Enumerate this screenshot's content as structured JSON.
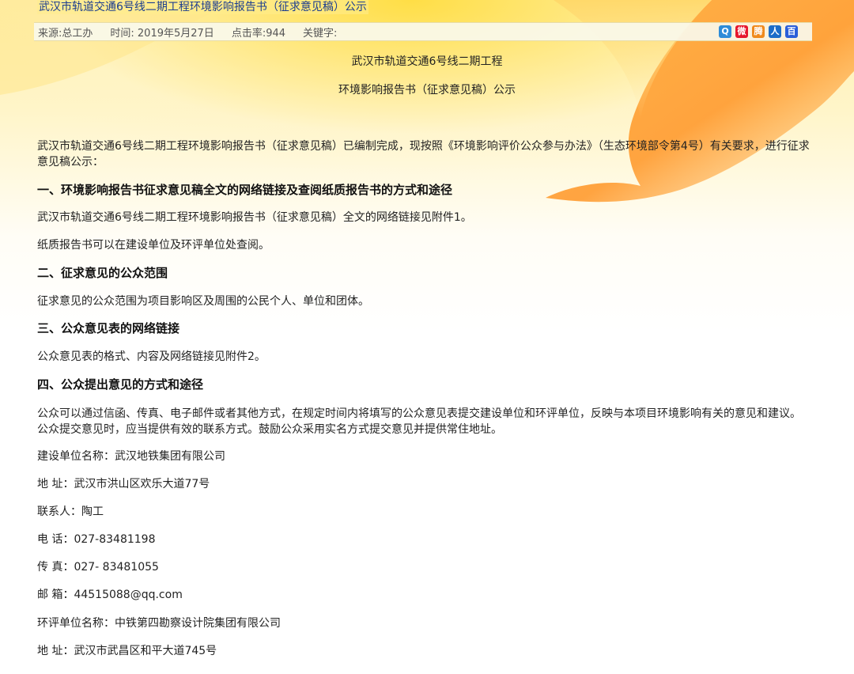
{
  "page": {
    "title": "武汉市轨道交通6号线二期工程环境影响报告书（征求意见稿）公示"
  },
  "meta": {
    "source": "来源:总工办",
    "time": "时间: 2019年5月27日",
    "hits": "点击率:944",
    "keywords": "关键字:"
  },
  "share_icons": [
    {
      "name": "qq-zone-icon",
      "glyph": "Q",
      "color": "#2d8cd9"
    },
    {
      "name": "weibo-icon",
      "glyph": "微",
      "color": "#e6162d"
    },
    {
      "name": "tencent-weibo-icon",
      "glyph": "腾",
      "color": "#f08a1c"
    },
    {
      "name": "renren-icon",
      "glyph": "人",
      "color": "#1c6dc8"
    },
    {
      "name": "baidu-icon",
      "glyph": "百",
      "color": "#2b5fd9"
    }
  ],
  "document": {
    "heading_line1": "武汉市轨道交通6号线二期工程",
    "heading_line2": "环境影响报告书（征求意见稿）公示",
    "intro": "武汉市轨道交通6号线二期工程环境影响报告书（征求意见稿）已编制完成，现按照《环境影响评价公众参与办法》（生态环境部令第4号）有关要求，进行征求意见稿公示：",
    "section1_title": "一、环境影响报告书征求意见稿全文的网络链接及查阅纸质报告书的方式和途径",
    "section1_p1": "武汉市轨道交通6号线二期工程环境影响报告书（征求意见稿）全文的网络链接见附件1。",
    "section1_p2": "纸质报告书可以在建设单位及环评单位处查阅。",
    "section2_title": "二、征求意见的公众范围",
    "section2_p1": "征求意见的公众范围为项目影响区及周围的公民个人、单位和团体。",
    "section3_title": "三、公众意见表的网络链接",
    "section3_p1": "公众意见表的格式、内容及网络链接见附件2。",
    "section4_title": "四、公众提出意见的方式和途径",
    "section4_p1": "公众可以通过信函、传真、电子邮件或者其他方式，在规定时间内将填写的公众意见表提交建设单位和环评单位，反映与本项目环境影响有关的意见和建议。公众提交意见时，应当提供有效的联系方式。鼓励公众采用实名方式提交意见并提供常住地址。",
    "builder_name": "建设单位名称：武汉地铁集团有限公司",
    "builder_address": "地 址：武汉市洪山区欢乐大道77号",
    "builder_contact": "联系人：陶工",
    "builder_phone": "电 话：027-83481198",
    "builder_fax": "传 真：027- 83481055",
    "builder_email": "邮 箱：44515088@qq.com",
    "eia_name": "环评单位名称：中铁第四勘察设计院集团有限公司",
    "eia_address": "地 址：武汉市武昌区和平大道745号"
  }
}
